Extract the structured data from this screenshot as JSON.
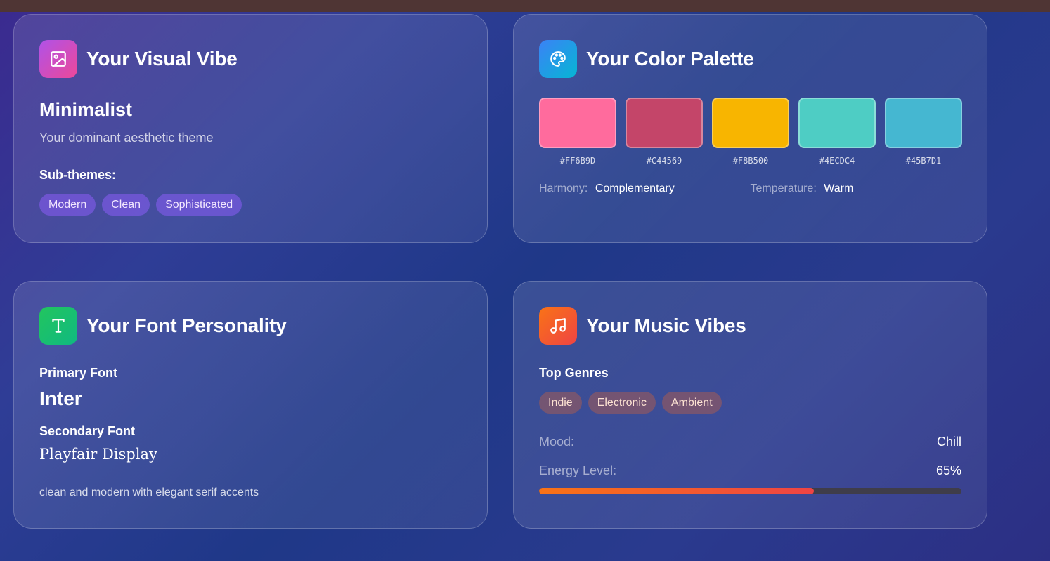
{
  "visual_vibe": {
    "title": "Your Visual Vibe",
    "icon": "image-icon",
    "theme": "Minimalist",
    "description": "Your dominant aesthetic theme",
    "subthemes_label": "Sub-themes:",
    "subthemes": [
      "Modern",
      "Clean",
      "Sophisticated"
    ]
  },
  "color_palette": {
    "title": "Your Color Palette",
    "icon": "palette-icon",
    "swatches": [
      {
        "hex": "#FF6B9D",
        "color": "#FF6B9D"
      },
      {
        "hex": "#C44569",
        "color": "#C44569"
      },
      {
        "hex": "#F8B500",
        "color": "#F8B500"
      },
      {
        "hex": "#4ECDC4",
        "color": "#4ECDC4"
      },
      {
        "hex": "#45B7D1",
        "color": "#45B7D1"
      }
    ],
    "harmony_label": "Harmony:",
    "harmony": "Complementary",
    "temperature_label": "Temperature:",
    "temperature": "Warm"
  },
  "font_personality": {
    "title": "Your Font Personality",
    "icon": "type-icon",
    "primary_label": "Primary Font",
    "primary": "Inter",
    "secondary_label": "Secondary Font",
    "secondary": "Playfair Display",
    "description": "clean and modern with elegant serif accents"
  },
  "music_vibes": {
    "title": "Your Music Vibes",
    "icon": "music-note-icon",
    "genres_label": "Top Genres",
    "genres": [
      "Indie",
      "Electronic",
      "Ambient"
    ],
    "mood_label": "Mood:",
    "mood": "Chill",
    "energy_label": "Energy Level:",
    "energy": "65%",
    "energy_value": 0.65
  },
  "colors": {
    "topbar": "#4f3534",
    "energy_bar_start": "#f97316",
    "energy_bar_end": "#ef4444"
  }
}
